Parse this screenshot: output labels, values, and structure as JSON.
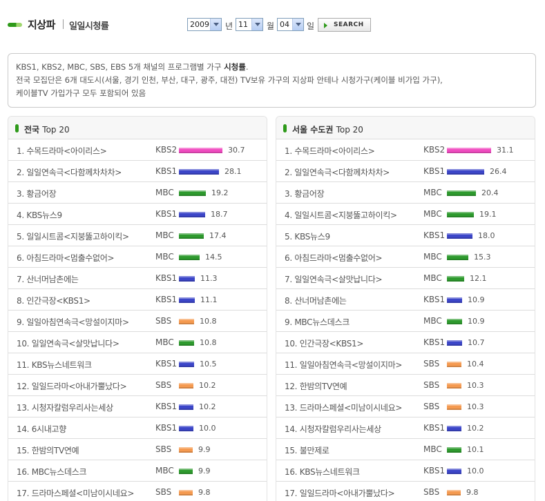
{
  "header": {
    "title": "지상파",
    "subtitle": "일일시청률",
    "year": "2009",
    "year_unit": "년",
    "month": "11",
    "month_unit": "월",
    "day": "04",
    "day_unit": "일",
    "search_label": "SEARCH"
  },
  "info": {
    "line1_pre": "KBS1, KBS2, MBC, SBS, EBS 5개 채널의 프로그램별 가구 ",
    "line1_bold": "시청률",
    "line1_post": ".",
    "line2": "전국 모집단은 6개 대도시(서울, 경기 인천, 부산, 대구, 광주, 대전) TV보유 가구의 지상파 안테나 시청가구(케이블 비가입 가구),",
    "line3": "케이블TV 가입가구 모두 포함되어 있음"
  },
  "colors": {
    "KBS1": "#3c46c8",
    "KBS2": "#f04cc0",
    "MBC": "#2e9a2e",
    "SBS": "#f59a50",
    "accent": "#2e9a1a"
  },
  "panels": [
    {
      "title_pre": "전국",
      "title_post": "Top 20",
      "rows": [
        {
          "rank": "1.",
          "name": "수목드라마<아이리스>",
          "channel": "KBS2",
          "value": "30.7"
        },
        {
          "rank": "2.",
          "name": "일일연속극<다함께차차차>",
          "channel": "KBS1",
          "value": "28.1"
        },
        {
          "rank": "3.",
          "name": "황금어장",
          "channel": "MBC",
          "value": "19.2"
        },
        {
          "rank": "4.",
          "name": "KBS뉴스9",
          "channel": "KBS1",
          "value": "18.7"
        },
        {
          "rank": "5.",
          "name": "일일시트콤<지붕뚫고하이킥>",
          "channel": "MBC",
          "value": "17.4"
        },
        {
          "rank": "6.",
          "name": "아침드라마<멈출수없어>",
          "channel": "MBC",
          "value": "14.5"
        },
        {
          "rank": "7.",
          "name": "산너머남촌에는",
          "channel": "KBS1",
          "value": "11.3"
        },
        {
          "rank": "8.",
          "name": "인간극장<KBS1>",
          "channel": "KBS1",
          "value": "11.1"
        },
        {
          "rank": "9.",
          "name": "일일아침연속극<망설이지마>",
          "channel": "SBS",
          "value": "10.8"
        },
        {
          "rank": "10.",
          "name": "일일연속극<살맛납니다>",
          "channel": "MBC",
          "value": "10.8"
        },
        {
          "rank": "11.",
          "name": "KBS뉴스네트워크",
          "channel": "KBS1",
          "value": "10.5"
        },
        {
          "rank": "12.",
          "name": "일일드라마<아내가뿔났다>",
          "channel": "SBS",
          "value": "10.2"
        },
        {
          "rank": "13.",
          "name": "시청자칼럼우리사는세상",
          "channel": "KBS1",
          "value": "10.2"
        },
        {
          "rank": "14.",
          "name": "6시내고향",
          "channel": "KBS1",
          "value": "10.0"
        },
        {
          "rank": "15.",
          "name": "한밤의TV연예",
          "channel": "SBS",
          "value": "9.9"
        },
        {
          "rank": "16.",
          "name": "MBC뉴스데스크",
          "channel": "MBC",
          "value": "9.9"
        },
        {
          "rank": "17.",
          "name": "드라마스페셜<미남이시네요>",
          "channel": "SBS",
          "value": "9.8"
        }
      ]
    },
    {
      "title_pre": "서울 수도권",
      "title_post": "Top 20",
      "rows": [
        {
          "rank": "1.",
          "name": "수목드라마<아이리스>",
          "channel": "KBS2",
          "value": "31.1"
        },
        {
          "rank": "2.",
          "name": "일일연속극<다함께차차차>",
          "channel": "KBS1",
          "value": "26.4"
        },
        {
          "rank": "3.",
          "name": "황금어장",
          "channel": "MBC",
          "value": "20.4"
        },
        {
          "rank": "4.",
          "name": "일일시트콤<지붕뚫고하이킥>",
          "channel": "MBC",
          "value": "19.1"
        },
        {
          "rank": "5.",
          "name": "KBS뉴스9",
          "channel": "KBS1",
          "value": "18.0"
        },
        {
          "rank": "6.",
          "name": "아침드라마<멈출수없어>",
          "channel": "MBC",
          "value": "15.3"
        },
        {
          "rank": "7.",
          "name": "일일연속극<살맛납니다>",
          "channel": "MBC",
          "value": "12.1"
        },
        {
          "rank": "8.",
          "name": "산너머남촌에는",
          "channel": "KBS1",
          "value": "10.9"
        },
        {
          "rank": "9.",
          "name": "MBC뉴스데스크",
          "channel": "MBC",
          "value": "10.9"
        },
        {
          "rank": "10.",
          "name": "인간극장<KBS1>",
          "channel": "KBS1",
          "value": "10.7"
        },
        {
          "rank": "11.",
          "name": "일일아침연속극<망설이지마>",
          "channel": "SBS",
          "value": "10.4"
        },
        {
          "rank": "12.",
          "name": "한밤의TV연예",
          "channel": "SBS",
          "value": "10.3"
        },
        {
          "rank": "13.",
          "name": "드라마스페셜<미남이시네요>",
          "channel": "SBS",
          "value": "10.3"
        },
        {
          "rank": "14.",
          "name": "시청자칼럼우리사는세상",
          "channel": "KBS1",
          "value": "10.2"
        },
        {
          "rank": "15.",
          "name": "불만제로",
          "channel": "MBC",
          "value": "10.1"
        },
        {
          "rank": "16.",
          "name": "KBS뉴스네트워크",
          "channel": "KBS1",
          "value": "10.0"
        },
        {
          "rank": "17.",
          "name": "일일드라마<아내가뿔났다>",
          "channel": "SBS",
          "value": "9.8"
        }
      ]
    }
  ]
}
